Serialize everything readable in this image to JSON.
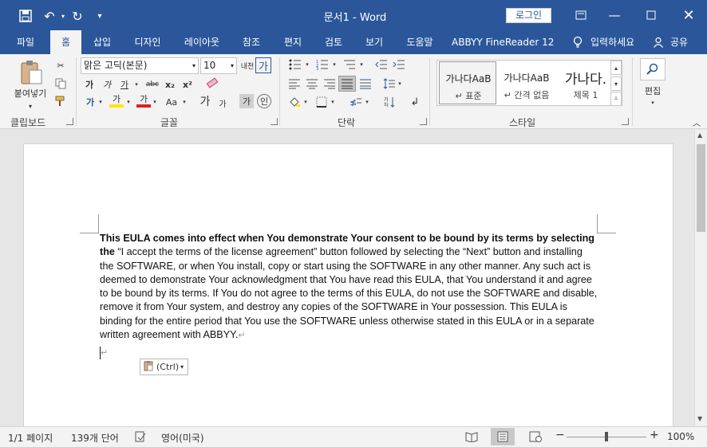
{
  "app": {
    "title": "문서1  -  Word",
    "login_label": "로그인"
  },
  "qat": {
    "save_icon": "save-icon",
    "undo_icon": "undo-icon",
    "redo_icon": "redo-icon",
    "customize_icon": "customize-qat-icon"
  },
  "tabs": [
    {
      "label": "파일"
    },
    {
      "label": "홈"
    },
    {
      "label": "삽입"
    },
    {
      "label": "디자인"
    },
    {
      "label": "레이아웃"
    },
    {
      "label": "참조"
    },
    {
      "label": "편지"
    },
    {
      "label": "검토"
    },
    {
      "label": "보기"
    },
    {
      "label": "도움말"
    },
    {
      "label": "ABBYY FineReader 12"
    },
    {
      "label": "입력하세요"
    },
    {
      "label": "공유"
    }
  ],
  "ribbon": {
    "clipboard": {
      "label": "클립보드",
      "paste_label": "붙여넣기"
    },
    "font": {
      "label": "글꼴",
      "font_name": "맑은 고딕(본문)",
      "font_size": "10",
      "bold": "가",
      "italic": "가",
      "underline": "가",
      "strike": "abc",
      "sub": "x₂",
      "sup": "x²",
      "grow": "가",
      "shrink": "가",
      "aa": "Aa",
      "fontcolor": "가",
      "highlight": "가",
      "effects": "가",
      "clear": "가",
      "phonetic": "내천",
      "charborder": "가",
      "charshade": "가",
      "enclosed": "㊞"
    },
    "paragraph": {
      "label": "단락"
    },
    "styles": {
      "label": "스타일",
      "items": [
        {
          "preview": "가나다AaB",
          "name": "↵ 표준"
        },
        {
          "preview": "가나다AaB",
          "name": "↵ 간격 없음"
        },
        {
          "preview": "가나다.",
          "name": "제목 1"
        }
      ]
    },
    "editing": {
      "label": "편집"
    }
  },
  "document": {
    "bold_lead": "This EULA comes into effect when You demonstrate Your consent to be bound by its terms by selecting the",
    "body": " “I accept the terms of the license agreement” button followed by selecting the “Next” button and installing the SOFTWARE, or when You install, copy or start using the SOFTWARE in any other manner. Any such act is deemed to demonstrate Your acknowledgment that You have read this EULA, that You understand it and agree to be bound by its terms. If You do not agree to the terms of this EULA, do not use the SOFTWARE and disable, remove it from Your system, and destroy any copies of the SOFTWARE in Your possession. This EULA is binding for the entire period that You use the SOFTWARE unless otherwise stated in this EULA or in a separate written agreement with ABBYY.",
    "pilcrow": "↵",
    "paste_options": "(Ctrl)"
  },
  "status": {
    "page": "1/1 페이지",
    "words": "139개 단어",
    "language": "영어(미국)",
    "zoom": "100%"
  },
  "colors": {
    "accent": "#2b579a",
    "ribbon": "#f3f3f3",
    "page": "#ffffff"
  }
}
